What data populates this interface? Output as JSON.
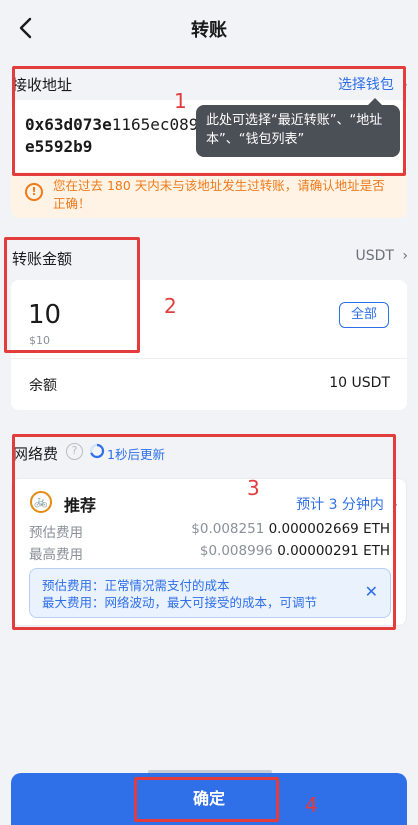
{
  "header": {
    "title": "转账"
  },
  "receive": {
    "label": "接收地址",
    "choose_wallet": "选择钱包",
    "address_bold_a": "0x63d073e",
    "address_thin": "1165ec089",
    "address_bold_b": "e5592b9",
    "tooltip": "此处可选择“最近转账”、“地址本”、“钱包列表”",
    "warning": "您在过去 180 天内未与该地址发生过转账，请确认地址是否正确！"
  },
  "amount": {
    "label": "转账金额",
    "token": "USDT",
    "value": "10",
    "usd": "$10",
    "all_button": "全部",
    "balance_label": "余额",
    "balance_value": "10 USDT"
  },
  "fee": {
    "label": "网络费",
    "refresh": "1秒后更新",
    "mode": "推荐",
    "eta": "预计 3 分钟内",
    "rows": [
      {
        "label": "预估费用",
        "usd": "$0.008251",
        "eth": "0.000002669 ETH"
      },
      {
        "label": "最高费用",
        "usd": "$0.008996",
        "eth": "0.00000291 ETH"
      }
    ],
    "note_line1": "预估费用：正常情况需支付的成本",
    "note_line2": "最大费用：网络波动，最大可接受的成本，可调节"
  },
  "confirm": {
    "label": "确定"
  },
  "annotations": [
    "1",
    "2",
    "3",
    "4"
  ]
}
